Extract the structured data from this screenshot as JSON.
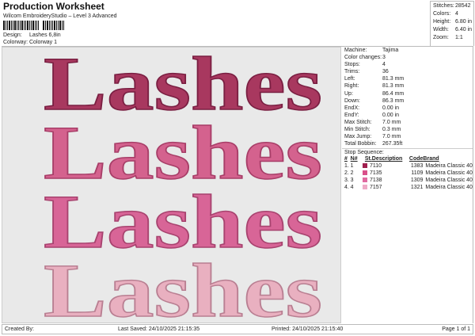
{
  "header": {
    "title": "Production Worksheet",
    "subtitle": "Wilcom EmbroideryStudio – Level 3 Advanced",
    "design_label": "Design:",
    "design_value": "Lashes 6,8in",
    "colorway_label": "Colorway:",
    "colorway_value": "Colorway 1"
  },
  "stats": [
    {
      "label": "Stitches:",
      "value": "28542"
    },
    {
      "label": "Colors:",
      "value": "4"
    },
    {
      "label": "Height:",
      "value": "6.80 in"
    },
    {
      "label": "Width:",
      "value": "6.40 in"
    },
    {
      "label": "Zoom:",
      "value": "1:1"
    }
  ],
  "design": {
    "text": "Lashes",
    "rows": [
      {
        "color": "#a8385f",
        "stroke": "#7a1f42"
      },
      {
        "color": "#d4628e",
        "stroke": "#a83e68"
      },
      {
        "color": "#d86597",
        "stroke": "#a8436f"
      },
      {
        "color": "#e9b0c0",
        "stroke": "#b97f92"
      }
    ]
  },
  "machine_info": [
    {
      "label": "Machine:",
      "value": "Tajima"
    },
    {
      "label": "Color changes:",
      "value": "3"
    },
    {
      "label": "Stops:",
      "value": "4"
    },
    {
      "label": "Trims:",
      "value": "36"
    },
    {
      "label": "Left:",
      "value": "81.3 mm"
    },
    {
      "label": "Right:",
      "value": "81.3 mm"
    },
    {
      "label": "Up:",
      "value": "86.4 mm"
    },
    {
      "label": "Down:",
      "value": "86.3 mm"
    },
    {
      "label": "EndX:",
      "value": "0.00 in"
    },
    {
      "label": "EndY:",
      "value": "0.00 in"
    },
    {
      "label": "Max Stitch:",
      "value": "7.0 mm"
    },
    {
      "label": "Min Stitch:",
      "value": "0.3 mm"
    },
    {
      "label": "Max Jump:",
      "value": "7.0 mm"
    },
    {
      "label": "Total Bobbin:",
      "value": "267.35ft"
    }
  ],
  "stop_sequence": {
    "title": "Stop Sequence:",
    "headers": [
      "#",
      "N#",
      "St.",
      "Description",
      "Code",
      "Brand"
    ],
    "rows": [
      {
        "num": "1.",
        "n": "1",
        "color": "#a0204f",
        "desc": "7110",
        "code": "1383",
        "brand": "Madeira Classic 40"
      },
      {
        "num": "2.",
        "n": "2",
        "color": "#d9508a",
        "desc": "7135",
        "code": "1109",
        "brand": "Madeira Classic 40"
      },
      {
        "num": "3.",
        "n": "3",
        "color": "#e06aa0",
        "desc": "7138",
        "code": "1309",
        "brand": "Madeira Classic 40"
      },
      {
        "num": "4.",
        "n": "4",
        "color": "#eeaac6",
        "desc": "7157",
        "code": "1321",
        "brand": "Madeira Classic 40"
      }
    ]
  },
  "footer": {
    "created_by": "Created By:",
    "last_saved": "Last Saved: 24/10/2025 21:15:35",
    "printed": "Printed: 24/10/2025 21:15:40",
    "page": "Page 1 of 1"
  }
}
